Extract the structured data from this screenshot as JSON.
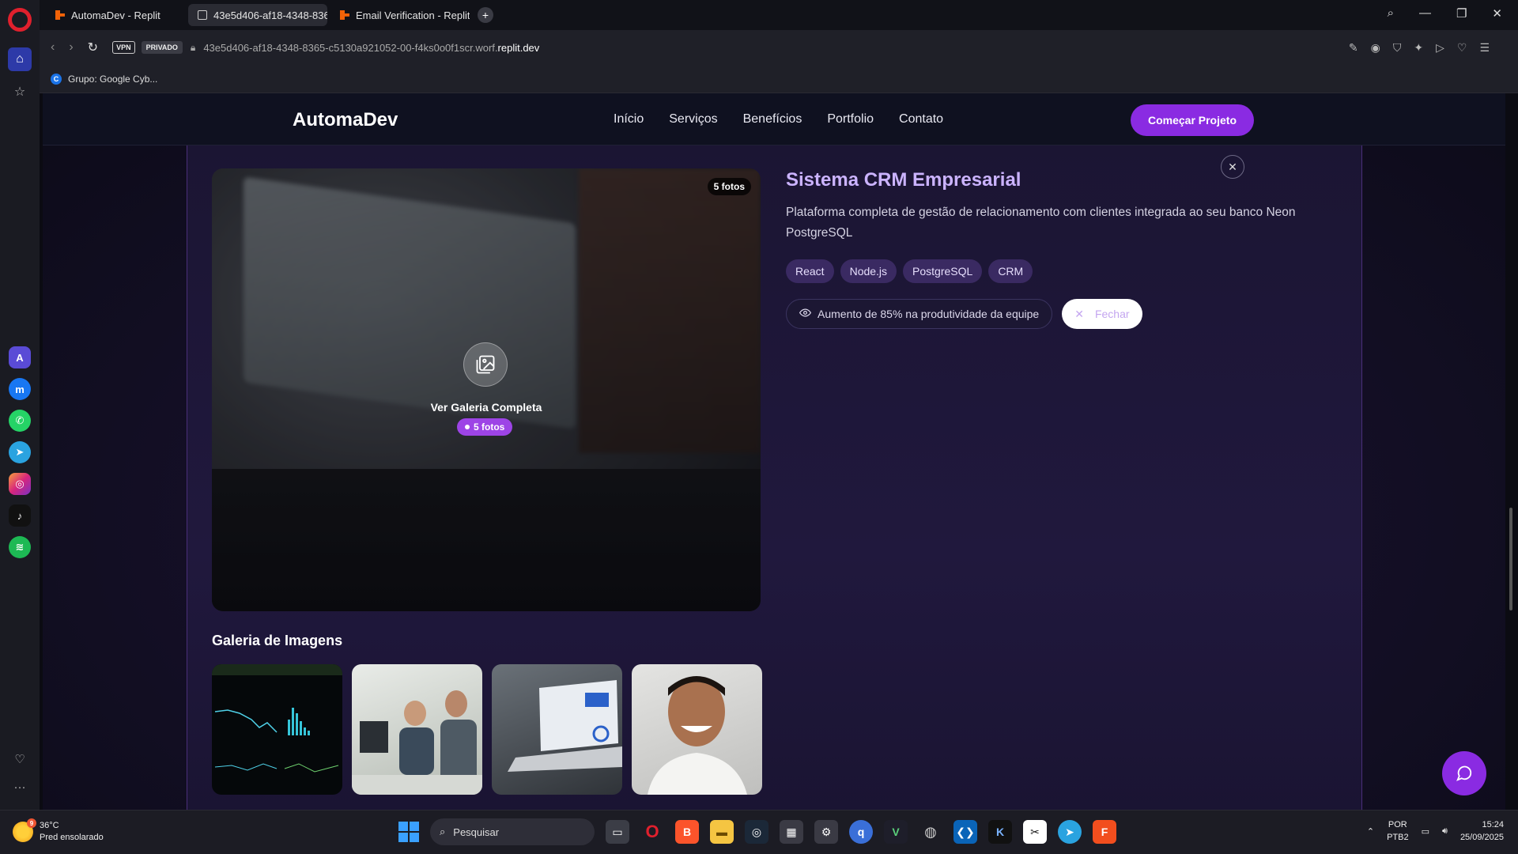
{
  "browser": {
    "tabs": [
      {
        "label": "AutomaDev - Replit",
        "active": false
      },
      {
        "label": "43e5d406-af18-4348-836",
        "active": true
      },
      {
        "label": "Email Verification - Replit",
        "active": false
      }
    ],
    "vpn": "VPN",
    "private": "PRIVADO",
    "url_prefix": "43e5d406-af18-4348-8365-c5130a921052-00-f4ks0o0f1scr.worf.",
    "url_domain": "replit.dev",
    "bookmark": "Grupo: Google Cyb...",
    "bookmark_icon": "C"
  },
  "site": {
    "brand": "AutomaDev",
    "nav": [
      "Início",
      "Serviços",
      "Benefícios",
      "Portfolio",
      "Contato"
    ],
    "cta": "Começar Projeto"
  },
  "project": {
    "photo_count_badge": "5 fotos",
    "gallery_label": "Ver Galeria Completa",
    "gallery_pill": "5 fotos",
    "title": "Sistema CRM Empresarial",
    "description": "Plataforma completa de gestão de relacionamento com clientes integrada ao seu banco Neon PostgreSQL",
    "tags": [
      "React",
      "Node.js",
      "PostgreSQL",
      "CRM"
    ],
    "result": "Aumento de 85% na produtividade da equipe",
    "close_label": "Fechar",
    "gallery_title": "Galeria de Imagens"
  },
  "taskbar": {
    "temp": "36°C",
    "weather": "Pred ensolarado",
    "weather_badge": "9",
    "search": "Pesquisar",
    "lang_1": "POR",
    "lang_2": "PTB2",
    "time": "15:24",
    "date": "25/09/2025"
  },
  "colors": {
    "accent": "#8a2be2",
    "title": "#cbb3ff",
    "tag_bg": "#3a2a62"
  }
}
